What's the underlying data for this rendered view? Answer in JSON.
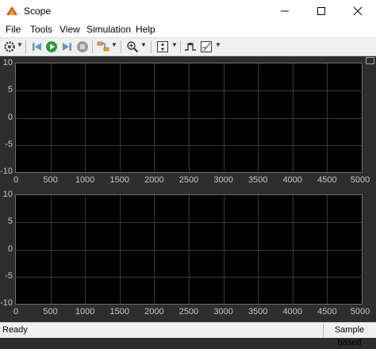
{
  "window": {
    "title": "Scope"
  },
  "menu": [
    "File",
    "Tools",
    "View",
    "Simulation",
    "Help"
  ],
  "toolbar": {
    "icons": [
      "settings-icon",
      "step-back-icon",
      "run-icon",
      "step-forward-icon",
      "stop-icon",
      "highlight-simulink-block-icon",
      "zoom-in-icon",
      "scale-axes-icon",
      "triggers-icon",
      "cursor-measurements-icon"
    ]
  },
  "colors": {
    "axes_bg": "#000000",
    "figure_bg": "#2d2d2d",
    "grid": "#3a3a3a",
    "tick_text": "#c8c8c8"
  },
  "chart_data": [
    {
      "type": "line",
      "series": [],
      "xlim": [
        0,
        5000
      ],
      "ylim": [
        -10,
        10
      ],
      "x_ticks": [
        "0",
        "500",
        "1000",
        "1500",
        "2000",
        "2500",
        "3000",
        "3500",
        "4000",
        "4500",
        "5000"
      ],
      "y_ticks": [
        "10",
        "5",
        "0",
        "-5",
        "-10"
      ],
      "grid": true
    },
    {
      "type": "line",
      "series": [],
      "xlim": [
        0,
        5000
      ],
      "ylim": [
        -10,
        10
      ],
      "x_ticks": [
        "0",
        "500",
        "1000",
        "1500",
        "2000",
        "2500",
        "3000",
        "3500",
        "4000",
        "4500",
        "5000"
      ],
      "y_ticks": [
        "10",
        "5",
        "0",
        "-5",
        "-10"
      ],
      "grid": true
    }
  ],
  "status": {
    "left": "Ready",
    "right": "Sample based"
  }
}
